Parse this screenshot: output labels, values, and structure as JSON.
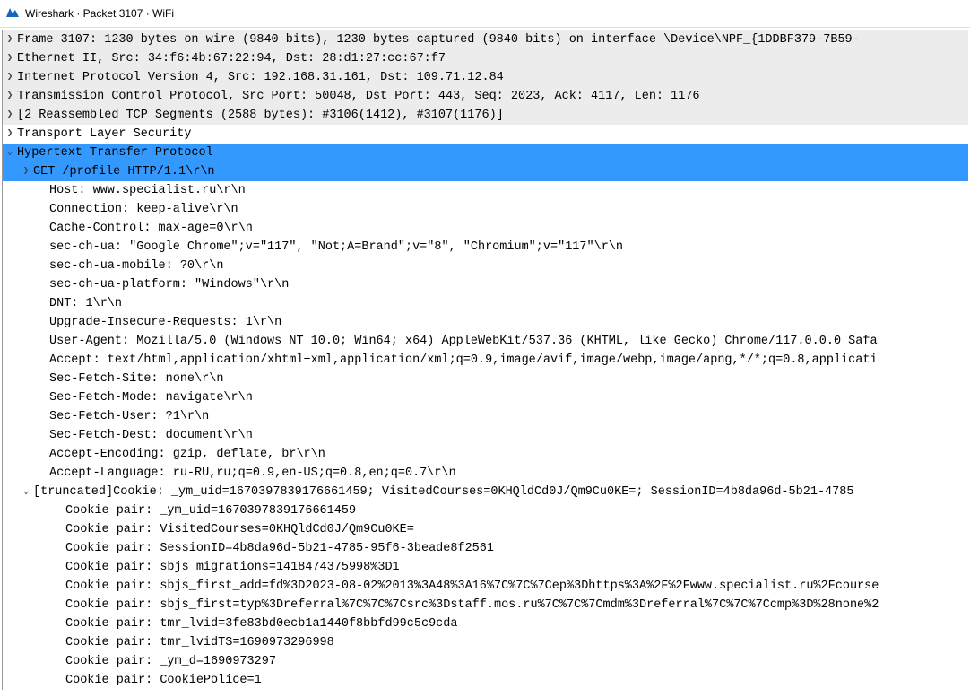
{
  "window": {
    "title": "Wireshark · Packet 3107 · WiFi"
  },
  "tree": {
    "frame": "Frame 3107: 1230 bytes on wire (9840 bits), 1230 bytes captured (9840 bits) on interface \\Device\\NPF_{1DDBF379-7B59-",
    "eth": "Ethernet II, Src: 34:f6:4b:67:22:94, Dst: 28:d1:27:cc:67:f7",
    "ip": "Internet Protocol Version 4, Src: 192.168.31.161, Dst: 109.71.12.84",
    "tcp": "Transmission Control Protocol, Src Port: 50048, Dst Port: 443, Seq: 2023, Ack: 4117, Len: 1176",
    "reasm": "[2 Reassembled TCP Segments (2588 bytes): #3106(1412), #3107(1176)]",
    "tls": "Transport Layer Security",
    "http": "Hypertext Transfer Protocol",
    "get": "GET /profile HTTP/1.1\\r\\n",
    "hdr": [
      "Host: www.specialist.ru\\r\\n",
      "Connection: keep-alive\\r\\n",
      "Cache-Control: max-age=0\\r\\n",
      "sec-ch-ua: \"Google Chrome\";v=\"117\", \"Not;A=Brand\";v=\"8\", \"Chromium\";v=\"117\"\\r\\n",
      "sec-ch-ua-mobile: ?0\\r\\n",
      "sec-ch-ua-platform: \"Windows\"\\r\\n",
      "DNT: 1\\r\\n",
      "Upgrade-Insecure-Requests: 1\\r\\n",
      "User-Agent: Mozilla/5.0 (Windows NT 10.0; Win64; x64) AppleWebKit/537.36 (KHTML, like Gecko) Chrome/117.0.0.0 Safa",
      "Accept: text/html,application/xhtml+xml,application/xml;q=0.9,image/avif,image/webp,image/apng,*/*;q=0.8,applicati",
      "Sec-Fetch-Site: none\\r\\n",
      "Sec-Fetch-Mode: navigate\\r\\n",
      "Sec-Fetch-User: ?1\\r\\n",
      "Sec-Fetch-Dest: document\\r\\n",
      "Accept-Encoding: gzip, deflate, br\\r\\n",
      "Accept-Language: ru-RU,ru;q=0.9,en-US;q=0.8,en;q=0.7\\r\\n"
    ],
    "cookie_trunc": " [truncated]Cookie: _ym_uid=1670397839176661459; VisitedCourses=0KHQldCd0J/Qm9Cu0KE=; SessionID=4b8da96d-5b21-4785",
    "cookies": [
      "Cookie pair: _ym_uid=1670397839176661459",
      "Cookie pair: VisitedCourses=0KHQldCd0J/Qm9Cu0KE=",
      "Cookie pair: SessionID=4b8da96d-5b21-4785-95f6-3beade8f2561",
      "Cookie pair: sbjs_migrations=1418474375998%3D1",
      "Cookie pair: sbjs_first_add=fd%3D2023-08-02%2013%3A48%3A16%7C%7C%7Cep%3Dhttps%3A%2F%2Fwww.specialist.ru%2Fcourse",
      "Cookie pair: sbjs_first=typ%3Dreferral%7C%7C%7Csrc%3Dstaff.mos.ru%7C%7C%7Cmdm%3Dreferral%7C%7C%7Ccmp%3D%28none%2",
      "Cookie pair: tmr_lvid=3fe83bd0ecb1a1440f8bbfd99c5c9cda",
      "Cookie pair: tmr_lvidTS=1690973296998",
      "Cookie pair: _ym_d=1690973297",
      "Cookie pair: CookiePolice=1"
    ]
  }
}
